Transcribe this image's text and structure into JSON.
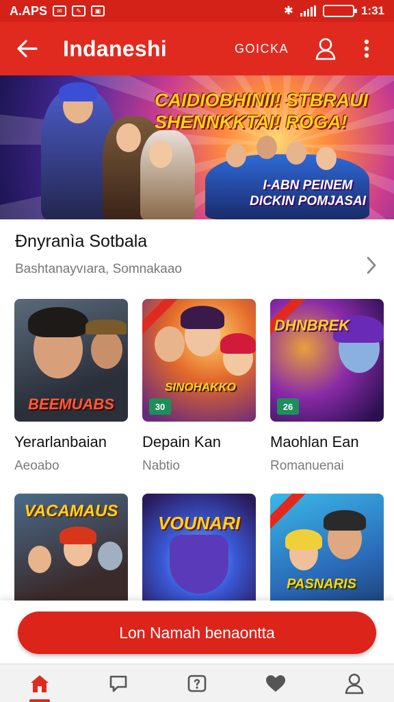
{
  "status_bar": {
    "left_text": "A.APS",
    "time": "1:31"
  },
  "app_bar": {
    "title": "Indaneshi",
    "action_label": "GOICKA",
    "icons": [
      "back-arrow-icon",
      "profile-icon",
      "more-vert-icon"
    ]
  },
  "banner": {
    "heading_line1": "CAIDIOBHINII!",
    "heading_line2": "STBRAUI",
    "heading_line3": "SHENNKKTAI!",
    "heading_line4": "ROGA!",
    "sub_line1": "I-ABN PEINEM",
    "sub_line2": "DICKIN POMJASAI"
  },
  "section": {
    "title": "Đnyranìa Sotbala",
    "subtitle": "Bashtanayvıara, Somnakaao"
  },
  "cards": [
    {
      "title": "Yerarlanbaian",
      "subtitle": "Aeoabo",
      "art_text": "BEEMUABS",
      "badge": ""
    },
    {
      "title": "Depain Kan",
      "subtitle": "Nabtio",
      "art_text": "SINOHAKKO",
      "badge": "30"
    },
    {
      "title": "Maohlan Ean",
      "subtitle": "Romanuenai",
      "art_text": "DHNBREK",
      "badge": "26"
    },
    {
      "title": "",
      "subtitle": "",
      "art_text": "VACAMAUS",
      "badge": ""
    },
    {
      "title": "",
      "subtitle": "",
      "art_text": "VOUNARI",
      "badge": ""
    },
    {
      "title": "",
      "subtitle": "",
      "art_text": "PASNARIS",
      "badge": ""
    }
  ],
  "cta": {
    "label": "Lon Namah benaontta"
  },
  "bottom_nav": {
    "items": [
      "home-icon",
      "chat-icon",
      "games-icon",
      "favorites-icon",
      "account-icon"
    ],
    "active": "home-icon"
  },
  "colors": {
    "accent": "#e02a20",
    "status_bar": "#d42218"
  }
}
